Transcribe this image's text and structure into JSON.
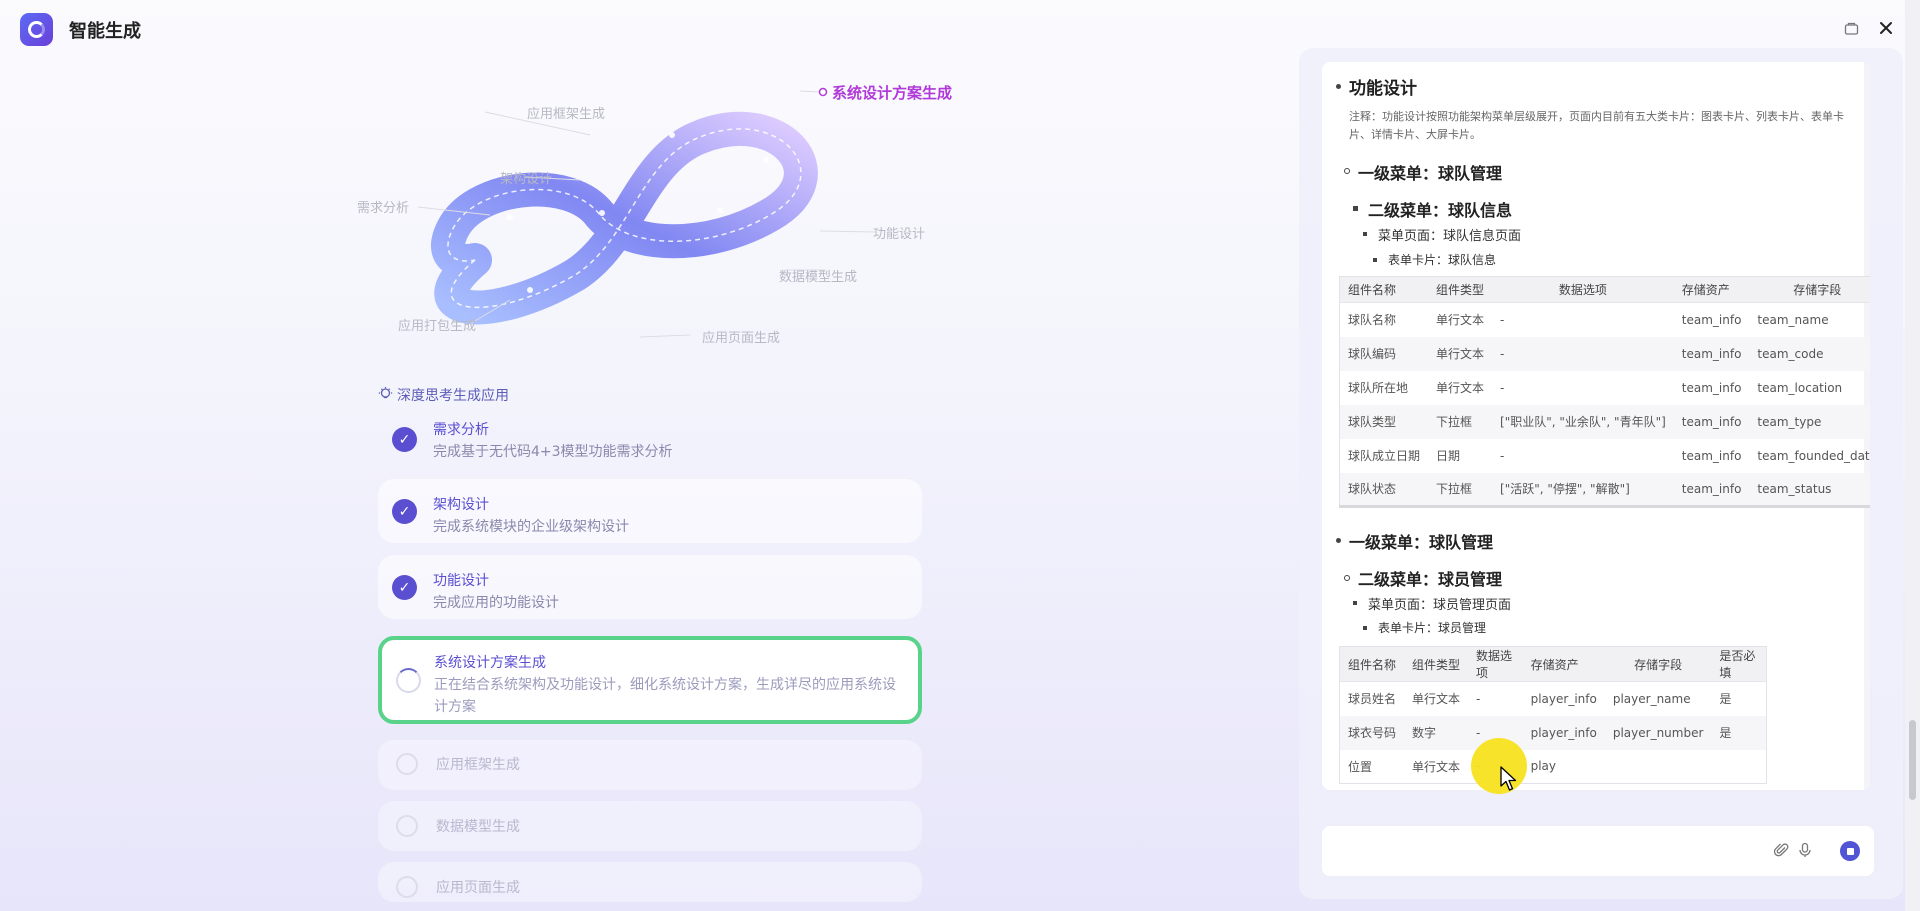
{
  "app": {
    "title": "智能生成"
  },
  "diagram": {
    "labels": {
      "framework": "应用框架生成",
      "architecture": "架构设计",
      "requirements": "需求分析",
      "function": "功能设计",
      "datamodel": "数据模型生成",
      "packaging": "应用打包生成",
      "pages": "应用页面生成",
      "system": "系统设计方案生成"
    }
  },
  "steps": {
    "header": "深度思考生成应用",
    "items": [
      {
        "title": "需求分析",
        "desc": "完成基于无代码4+3模型功能需求分析",
        "status": "done"
      },
      {
        "title": "架构设计",
        "desc": "完成系统模块的企业级架构设计",
        "status": "done"
      },
      {
        "title": "功能设计",
        "desc": "完成应用的功能设计",
        "status": "done"
      },
      {
        "title": "系统设计方案生成",
        "desc": "正在结合系统架构及功能设计，细化系统设计方案，生成详尽的应用系统设计方案",
        "status": "running"
      },
      {
        "title": "应用框架生成",
        "status": "pending"
      },
      {
        "title": "数据模型生成",
        "status": "pending"
      },
      {
        "title": "应用页面生成",
        "status": "pending"
      }
    ]
  },
  "doc": {
    "section_title": "功能设计",
    "note": "注释：功能设计按照功能架构菜单层级展开，页面内目前有五大类卡片：图表卡片、列表卡片、表单卡片、详情卡片、大屏卡片。",
    "menu1_a": "一级菜单：球队管理",
    "menu2_a": "二级菜单：球队信息",
    "page_a": "菜单页面：球队信息页面",
    "card_a": "表单卡片：球队信息",
    "table1": {
      "headers": [
        "组件名称",
        "组件类型",
        "数据选项",
        "存储资产",
        "存储字段"
      ],
      "rows": [
        [
          "球队名称",
          "单行文本",
          "-",
          "team_info",
          "team_name"
        ],
        [
          "球队编码",
          "单行文本",
          "-",
          "team_info",
          "team_code"
        ],
        [
          "球队所在地",
          "单行文本",
          "-",
          "team_info",
          "team_location"
        ],
        [
          "球队类型",
          "下拉框",
          "[\"职业队\", \"业余队\", \"青年队\"]",
          "team_info",
          "team_type"
        ],
        [
          "球队成立日期",
          "日期",
          "-",
          "team_info",
          "team_founded_date"
        ],
        [
          "球队状态",
          "下拉框",
          "[\"活跃\", \"停摆\", \"解散\"]",
          "team_info",
          "team_status"
        ]
      ]
    },
    "menu1_b": "一级菜单：球队管理",
    "menu2_b": "二级菜单：球员管理",
    "page_b": "菜单页面：球员管理页面",
    "card_b": "表单卡片：球员管理",
    "table2": {
      "headers": [
        "组件名称",
        "组件类型",
        "数据选项",
        "存储资产",
        "存储字段",
        "是否必填"
      ],
      "rows": [
        [
          "球员姓名",
          "单行文本",
          "-",
          "player_info",
          "player_name",
          "是"
        ],
        [
          "球衣号码",
          "数字",
          "-",
          "player_info",
          "player_number",
          "是"
        ],
        [
          "位置",
          "单行文本",
          "-",
          "play",
          "",
          ""
        ]
      ]
    }
  },
  "input": {
    "placeholder": ""
  },
  "icons": {
    "attach": "paperclip-icon",
    "mic": "microphone-icon",
    "stop": "stop-icon",
    "close": "close-icon",
    "minimize": "window-icon"
  },
  "colors": {
    "accent": "#5a4fd1",
    "active_border": "#5ad38a",
    "active_label": "#b03ad9"
  }
}
